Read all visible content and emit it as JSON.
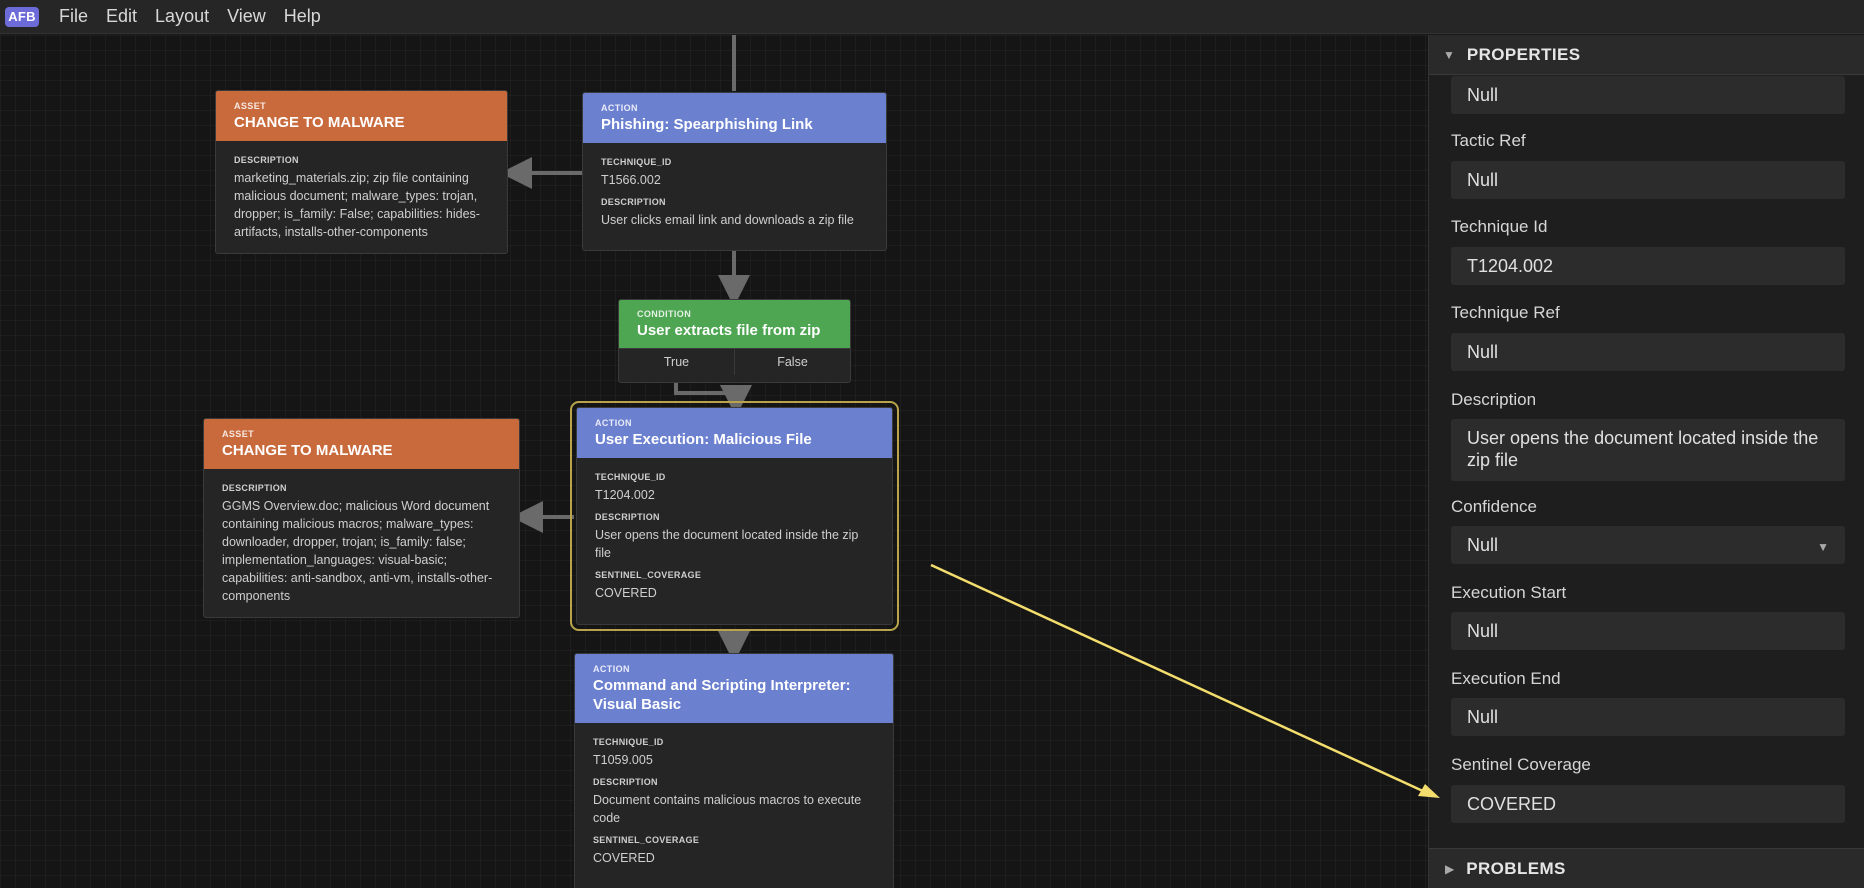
{
  "app": {
    "logo": "AFB",
    "menu": [
      "File",
      "Edit",
      "Layout",
      "View",
      "Help"
    ]
  },
  "canvas": {
    "nodes": {
      "asset1": {
        "type": "ASSET",
        "title": "CHANGE TO MALWARE",
        "fields": [
          {
            "key": "DESCRIPTION",
            "value": "marketing_materials.zip; zip file containing malicious document; malware_types: trojan, dropper; is_family: False; capabilities: hides-artifacts, installs-other-components"
          }
        ]
      },
      "action1": {
        "type": "ACTION",
        "title": "Phishing: Spearphishing Link",
        "fields": [
          {
            "key": "TECHNIQUE_ID",
            "value": "T1566.002"
          },
          {
            "key": "DESCRIPTION",
            "value": "User clicks email link and downloads a zip file"
          }
        ]
      },
      "condition1": {
        "type": "CONDITION",
        "title": "User extracts file from zip",
        "branches": [
          "True",
          "False"
        ]
      },
      "asset2": {
        "type": "ASSET",
        "title": "CHANGE TO MALWARE",
        "fields": [
          {
            "key": "DESCRIPTION",
            "value": "GGMS Overview.doc; malicious Word document containing malicious macros; malware_types: downloader, dropper, trojan; is_family: false; implementation_languages: visual-basic; capabilities: anti-sandbox, anti-vm, installs-other-components"
          }
        ]
      },
      "action2": {
        "type": "ACTION",
        "title": "User Execution: Malicious File",
        "fields": [
          {
            "key": "TECHNIQUE_ID",
            "value": "T1204.002"
          },
          {
            "key": "DESCRIPTION",
            "value": "User opens the document located inside the zip file"
          },
          {
            "key": "SENTINEL_COVERAGE",
            "value": "COVERED"
          }
        ]
      },
      "action3": {
        "type": "ACTION",
        "title": "Command and Scripting Interpreter: Visual Basic",
        "fields": [
          {
            "key": "TECHNIQUE_ID",
            "value": "T1059.005"
          },
          {
            "key": "DESCRIPTION",
            "value": "Document contains malicious macros to execute code"
          },
          {
            "key": "SENTINEL_COVERAGE",
            "value": "COVERED"
          }
        ]
      }
    }
  },
  "properties": {
    "header": "PROPERTIES",
    "top_value": "Null",
    "fields": [
      {
        "label": "Tactic Ref",
        "value": "Null"
      },
      {
        "label": "Technique Id",
        "value": "T1204.002"
      },
      {
        "label": "Technique Ref",
        "value": "Null"
      },
      {
        "label": "Description",
        "value": "User opens the document located inside the zip file"
      },
      {
        "label": "Confidence",
        "value": "Null"
      },
      {
        "label": "Execution Start",
        "value": "Null"
      },
      {
        "label": "Execution End",
        "value": "Null"
      },
      {
        "label": "Sentinel Coverage",
        "value": "COVERED"
      }
    ],
    "problems_header": "PROBLEMS"
  },
  "colors": {
    "asset": "#c96a3c",
    "action": "#6c80d0",
    "condition": "#4ea552",
    "annotation_arrow": "#f3dd6d"
  }
}
